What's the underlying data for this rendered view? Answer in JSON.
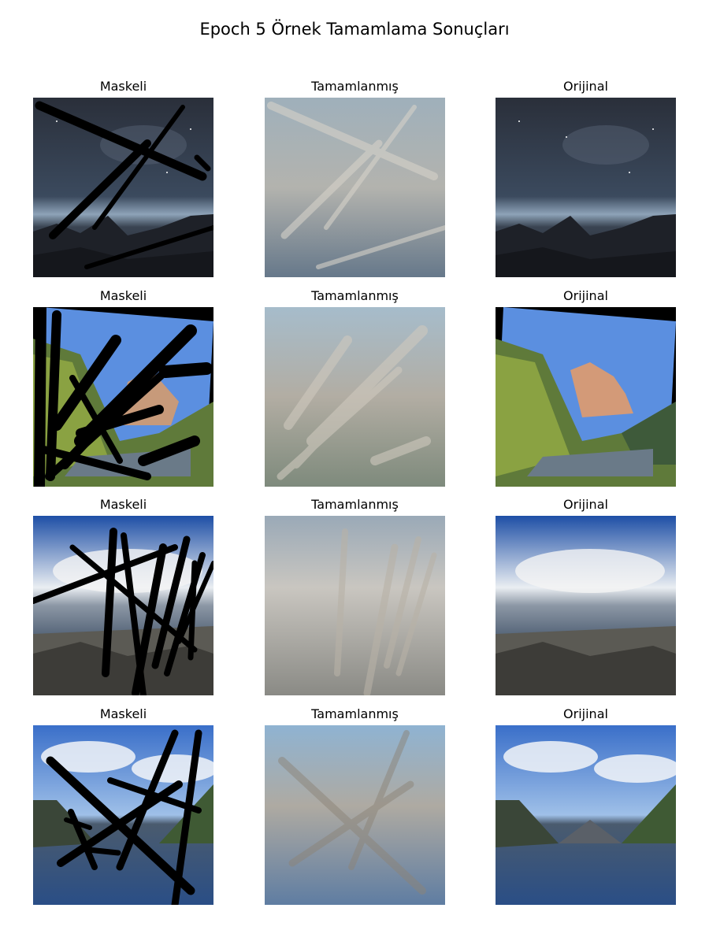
{
  "figure": {
    "title": "Epoch 5 Örnek Tamamlama Sonuçları"
  },
  "columns": [
    "Maskeli",
    "Tamamlanmış",
    "Orijinal"
  ],
  "rows": [
    {
      "scene": "night-sky-rocky-coast",
      "panels": [
        {
          "title": "Maskeli",
          "kind": "masked",
          "image": "night-milky-way-over-rocky-shore"
        },
        {
          "title": "Tamamlanmış",
          "kind": "completed",
          "image": "blurred-grey-reconstruction"
        },
        {
          "title": "Orijinal",
          "kind": "original",
          "image": "night-milky-way-over-rocky-shore"
        }
      ]
    },
    {
      "scene": "autumn-mountain-valley-lake",
      "panels": [
        {
          "title": "Maskeli",
          "kind": "masked",
          "image": "rotated-mountain-valley-with-lake"
        },
        {
          "title": "Tamamlanmış",
          "kind": "completed",
          "image": "blurred-grey-reconstruction"
        },
        {
          "title": "Orijinal",
          "kind": "original",
          "image": "rotated-mountain-valley-with-lake"
        }
      ]
    },
    {
      "scene": "cloudy-sky-rocky-ridge",
      "panels": [
        {
          "title": "Maskeli",
          "kind": "masked",
          "image": "fisheye-clouds-over-rocky-ridge"
        },
        {
          "title": "Tamamlanmış",
          "kind": "completed",
          "image": "blurred-grey-reconstruction"
        },
        {
          "title": "Orijinal",
          "kind": "original",
          "image": "fisheye-clouds-over-rocky-ridge"
        }
      ]
    },
    {
      "scene": "fjord-reflection",
      "panels": [
        {
          "title": "Maskeli",
          "kind": "masked",
          "image": "fjord-with-mountain-reflection"
        },
        {
          "title": "Tamamlanmış",
          "kind": "completed",
          "image": "blurred-grey-reconstruction"
        },
        {
          "title": "Orijinal",
          "kind": "original",
          "image": "fjord-with-mountain-reflection"
        }
      ]
    }
  ],
  "colors": {
    "mask": "#000000",
    "background": "#ffffff"
  }
}
